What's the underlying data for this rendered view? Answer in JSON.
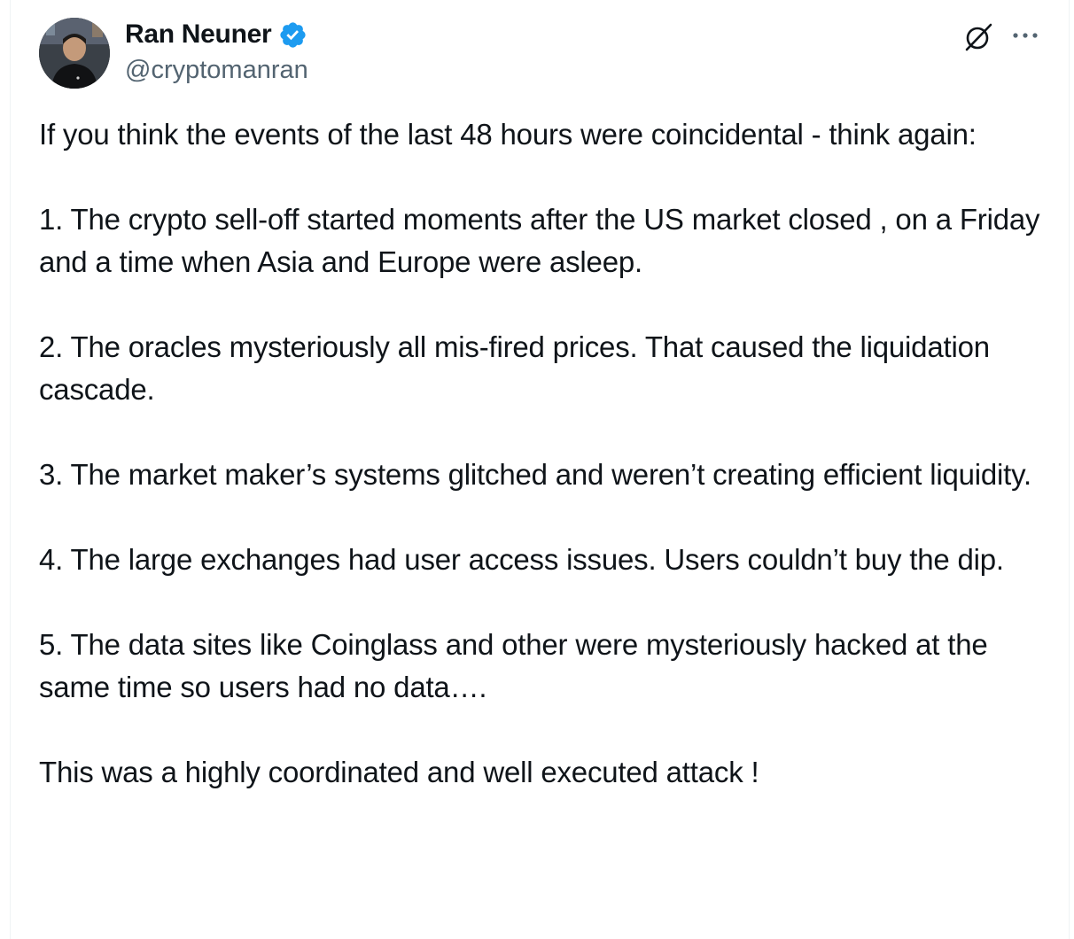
{
  "author": {
    "name": "Ran Neuner",
    "handle": "@cryptomanran",
    "verified": true
  },
  "icons": {
    "verified_badge": "verified-badge-icon",
    "grok": "grok-icon",
    "more": "more-options-icon"
  },
  "colors": {
    "verified": "#1d9bf0",
    "text": "#0f1419",
    "secondary": "#536471"
  },
  "post": {
    "paragraphs": [
      "If you think the events of the last 48 hours were coincidental - think again:",
      "1. The crypto sell-off started moments after the US market closed , on a Friday and a time when Asia and Europe were asleep.",
      "2. The oracles mysteriously all mis-fired prices. That caused the liquidation cascade.",
      "3. The market maker’s systems glitched and weren’t creating efficient liquidity.",
      "4. The large exchanges had user access issues. Users couldn’t buy the dip.",
      "5. The data sites like Coinglass and other were mysteriously hacked at the same time so users had no data….",
      "This was a highly coordinated and well executed attack !"
    ]
  }
}
